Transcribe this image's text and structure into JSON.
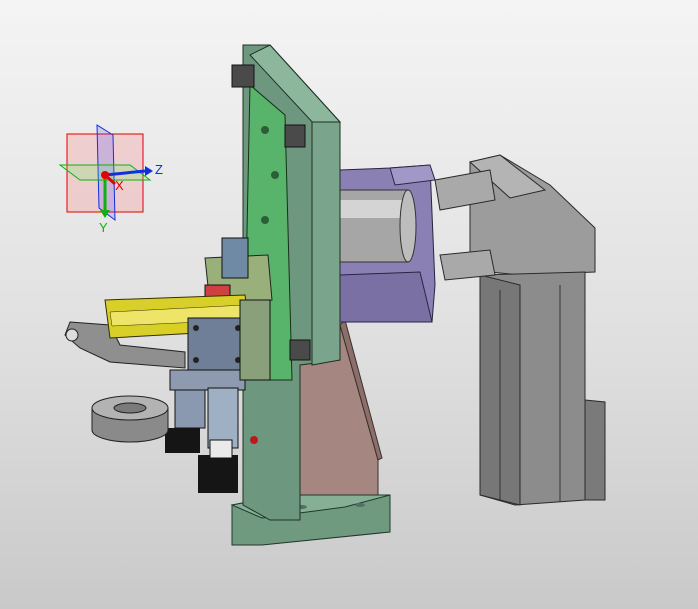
{
  "viewport": {
    "background": [
      "#f4f4f4",
      "#c9c9c9"
    ]
  },
  "triad": {
    "x_label": "X",
    "y_label": "Y",
    "z_label": "Z",
    "x_color": "#e00000",
    "y_color": "#10b010",
    "z_color": "#1030e0"
  },
  "model": {
    "colors": {
      "green_plate": "#77a18a",
      "green_bright": "#58b46a",
      "purple": "#8a80b4",
      "motor_gray": "#8f8f8f",
      "yellow": "#d8d028",
      "slate": "#6f7f98",
      "brown": "#a58680",
      "black": "#151515",
      "ring": "#9a9a9a"
    },
    "parts": [
      "base-plate",
      "vertical-plate",
      "mounting-bracket",
      "flange",
      "motor-shaft",
      "gear-motor",
      "gripper-arm",
      "linear-slide",
      "cylinder-block",
      "collet-ring",
      "support-rib",
      "clamp-fingers"
    ]
  }
}
